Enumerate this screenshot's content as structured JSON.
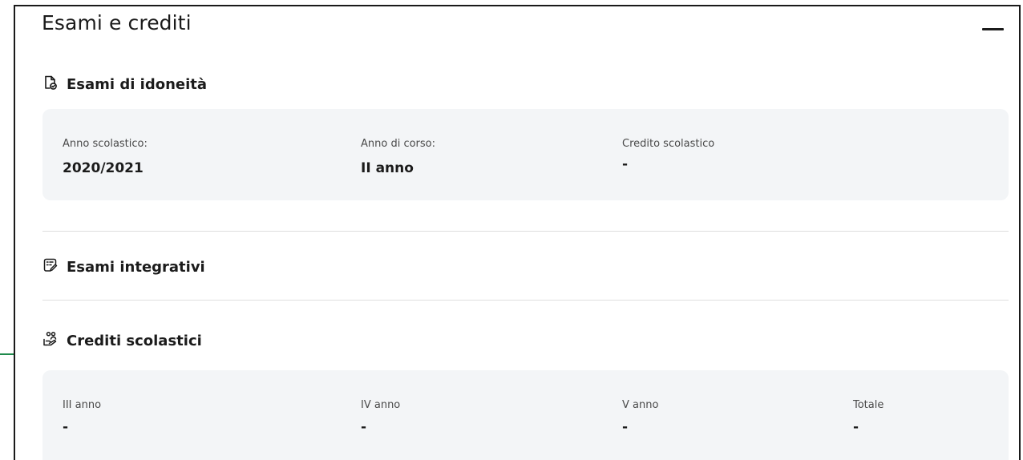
{
  "card": {
    "title": "Esami e crediti",
    "collapse_symbol": "minus-icon"
  },
  "esami_idoneita": {
    "heading": "Esami di idoneità",
    "icon": "document-check-icon",
    "fields": [
      {
        "label": "Anno scolastico:",
        "value": "2020/2021"
      },
      {
        "label": "Anno di corso:",
        "value": "II anno"
      },
      {
        "label": "Credito scolastico",
        "value": "-"
      }
    ]
  },
  "esami_integrativi": {
    "heading": "Esami integrativi",
    "icon": "document-edit-icon"
  },
  "crediti_scolastici": {
    "heading": "Crediti scolastici",
    "icon": "users-hand-icon",
    "fields": [
      {
        "label": "III anno",
        "value": "-"
      },
      {
        "label": "IV anno",
        "value": "-"
      },
      {
        "label": "V anno",
        "value": "-"
      },
      {
        "label": "Totale",
        "value": "-"
      }
    ]
  },
  "colors": {
    "accent_green": "#1e8a4c",
    "box_background": "#f3f5f7",
    "text": "#1b1b1b"
  }
}
